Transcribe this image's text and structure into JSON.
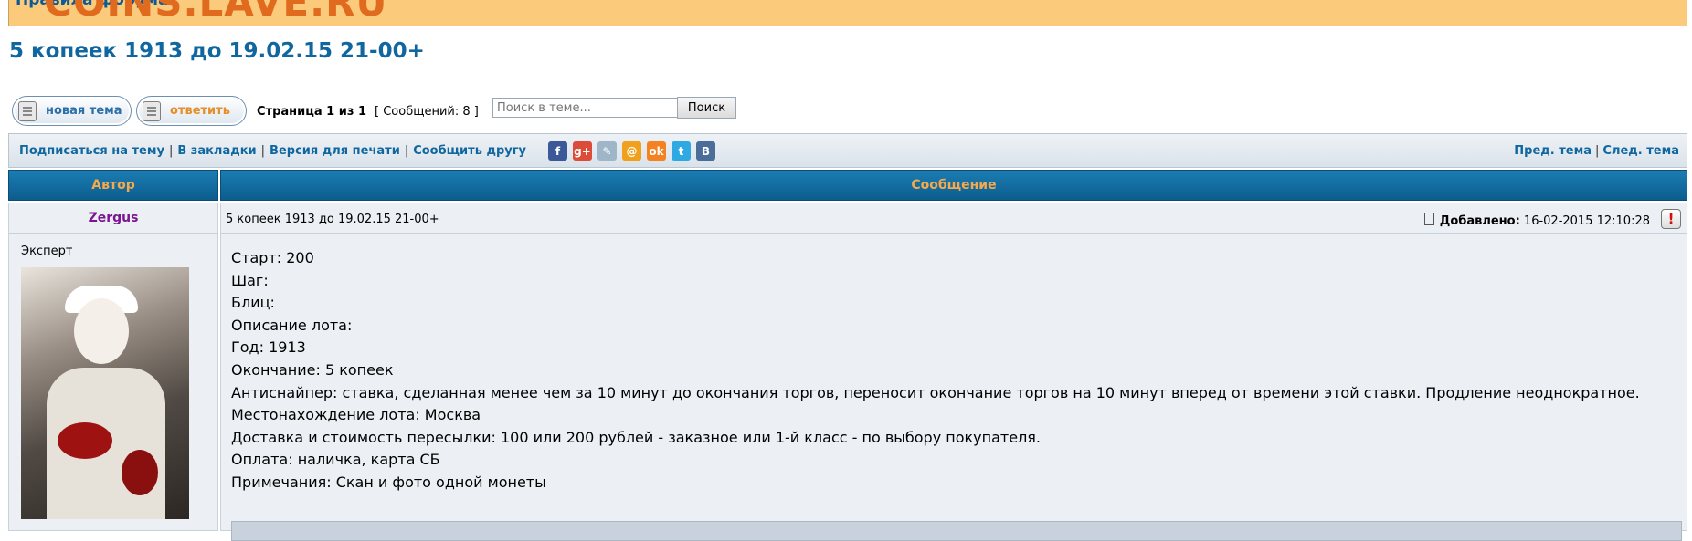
{
  "banner": {
    "link": "Правила форума",
    "logo": "COINS.LAVE.RU"
  },
  "topic": {
    "title": "5 копеек 1913 до 19.02.15 21-00+"
  },
  "buttons": {
    "new_topic": "новая тема",
    "reply": "ответить"
  },
  "pagination": {
    "text": "Страница 1 из 1",
    "messages": "[ Сообщений: 8 ]"
  },
  "search": {
    "placeholder": "Поиск в теме...",
    "button": "Поиск"
  },
  "toolbar": {
    "subscribe": "Подписаться на тему",
    "bookmarks": "В закладки",
    "print": "Версия для печати",
    "tell_friend": "Сообщить другу",
    "social": [
      {
        "glyph": "f",
        "color": "#3b5998"
      },
      {
        "glyph": "g+",
        "color": "#dd4b39"
      },
      {
        "glyph": "✎",
        "color": "#9fb5c8"
      },
      {
        "glyph": "@",
        "color": "#f0a01a"
      },
      {
        "glyph": "ok",
        "color": "#f58220"
      },
      {
        "glyph": "t",
        "color": "#2fa9e1"
      },
      {
        "glyph": "B",
        "color": "#4b6d99"
      }
    ],
    "prev": "Пред. тема",
    "next": "След. тема"
  },
  "table": {
    "author_header": "Автор",
    "message_header": "Сообщение"
  },
  "post": {
    "author": "Zergus",
    "rank": "Эксперт",
    "subject": "5 копеек 1913 до 19.02.15 21-00+",
    "added_label": "Добавлено:",
    "added_date": "16-02-2015 12:10:28",
    "report_glyph": "!",
    "lines": [
      "Старт: 200",
      "Шаг:",
      "Блиц:",
      "Описание лота:",
      "Год: 1913",
      "Окончание: 5 копеек",
      "Антиснайпер: ставка, сделанная менее чем за 10 минут до окончания торгов, переносит окончание торгов на 10 минут вперед от времени этой ставки. Продление неоднократное.",
      "Местонахождение лота: Москва",
      "Доставка и стоимость пересылки: 100 или 200 рублей - заказное или 1-й класс - по выбору покупателя.",
      "Оплата: наличка, карта СБ",
      "Примечания: Скан и фото одной монеты"
    ]
  }
}
